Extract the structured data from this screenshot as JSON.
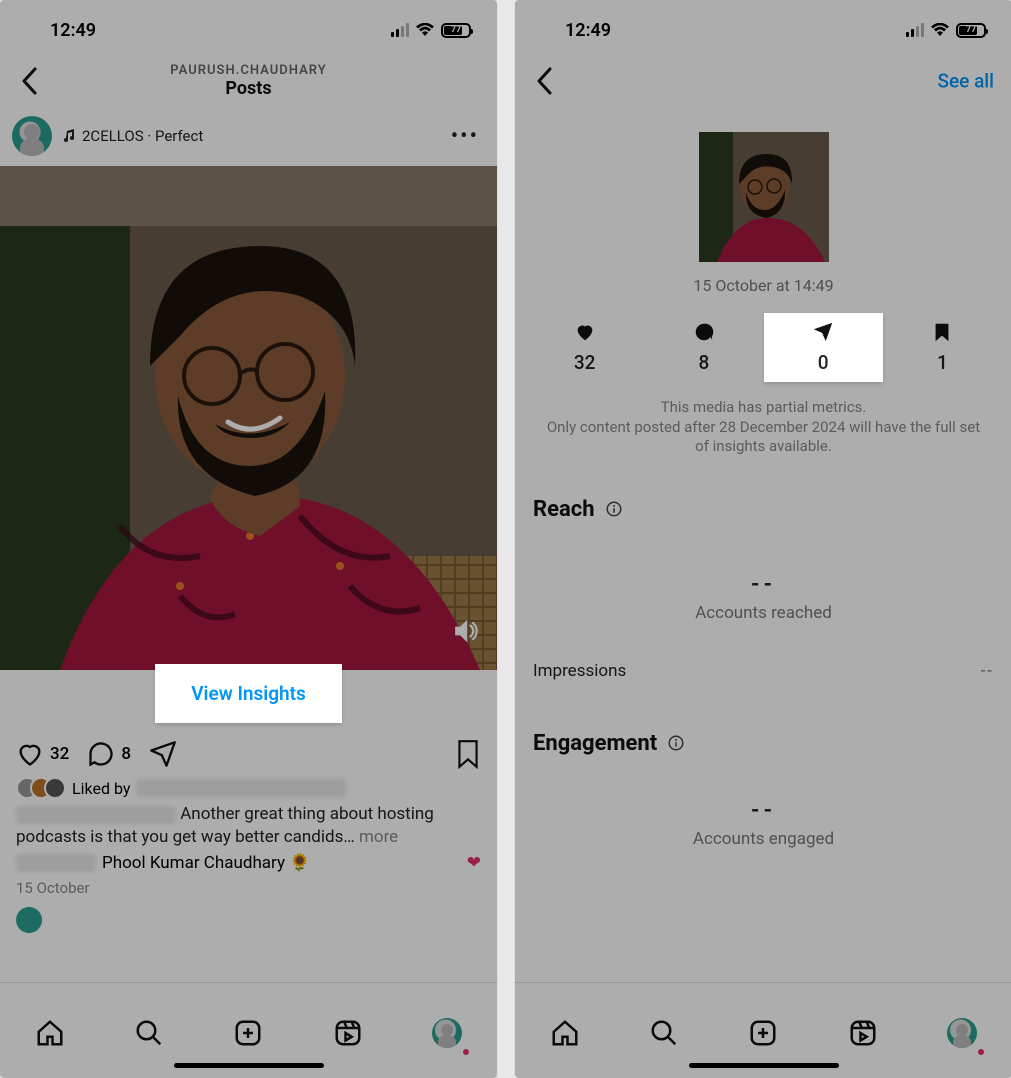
{
  "left": {
    "status": {
      "time": "12:49",
      "battery": "77"
    },
    "nav": {
      "username": "PAURUSH.CHAUDHARY",
      "title": "Posts"
    },
    "post": {
      "music": "2CELLOS · Perfect",
      "view_insights": "View Insights",
      "likes": "32",
      "comments": "8",
      "liked_by_prefix": "Liked by",
      "caption_cont": "Another great thing about hosting podcasts is that you get way better candids…",
      "more": "more",
      "comment_name": "Phool Kumar Chaudhary",
      "comment_emoji": "🌻",
      "date": "15 October"
    }
  },
  "right": {
    "status": {
      "time": "12:49",
      "battery": "77"
    },
    "see_all": "See all",
    "post_time": "15 October at 14:49",
    "metrics": {
      "likes": "32",
      "comments": "8",
      "shares": "0",
      "saves": "1"
    },
    "disclaimer1": "This media has partial metrics.",
    "disclaimer2": "Only content posted after 28 December 2024 will have the full set of insights available.",
    "reach": {
      "title": "Reach",
      "value": "--",
      "label": "Accounts reached",
      "impressions_label": "Impressions",
      "impressions_value": "--"
    },
    "engagement": {
      "title": "Engagement",
      "value": "--",
      "label": "Accounts engaged"
    }
  }
}
